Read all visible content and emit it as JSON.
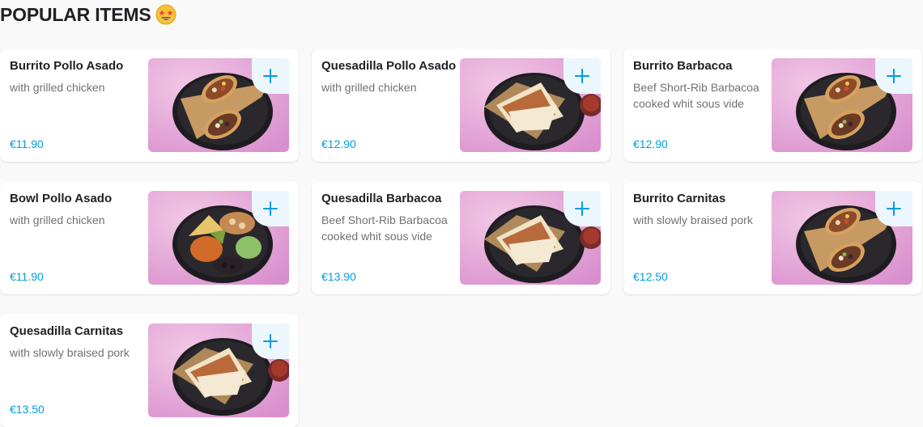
{
  "section": {
    "title": "POPULAR ITEMS",
    "emoji_icon": "star-struck-emoji-icon"
  },
  "colors": {
    "price": "#009de0",
    "add_button_bg": "#ebf7fd",
    "image_bg": "#e8b4dc"
  },
  "items": [
    {
      "name": "Burrito Pollo Asado",
      "description": "with grilled chicken",
      "price": "€11.90",
      "image": "burrito"
    },
    {
      "name": "Quesadilla Pollo Asado",
      "description": "with grilled chicken",
      "price": "€12.90",
      "image": "quesadilla"
    },
    {
      "name": "Burrito Barbacoa",
      "description": "Beef Short-Rib Barbacoa cooked whit sous vide",
      "price": "€12.90",
      "image": "burrito"
    },
    {
      "name": "Bowl Pollo Asado",
      "description": "with grilled chicken",
      "price": "€11.90",
      "image": "bowl"
    },
    {
      "name": "Quesadilla Barbacoa",
      "description": "Beef Short-Rib Barbacoa cooked whit sous vide",
      "price": "€13.90",
      "image": "quesadilla"
    },
    {
      "name": "Burrito Carnitas",
      "description": "with slowly braised pork",
      "price": "€12.50",
      "image": "burrito"
    },
    {
      "name": "Quesadilla Carnitas",
      "description": "with slowly braised pork",
      "price": "€13.50",
      "image": "quesadilla"
    }
  ]
}
